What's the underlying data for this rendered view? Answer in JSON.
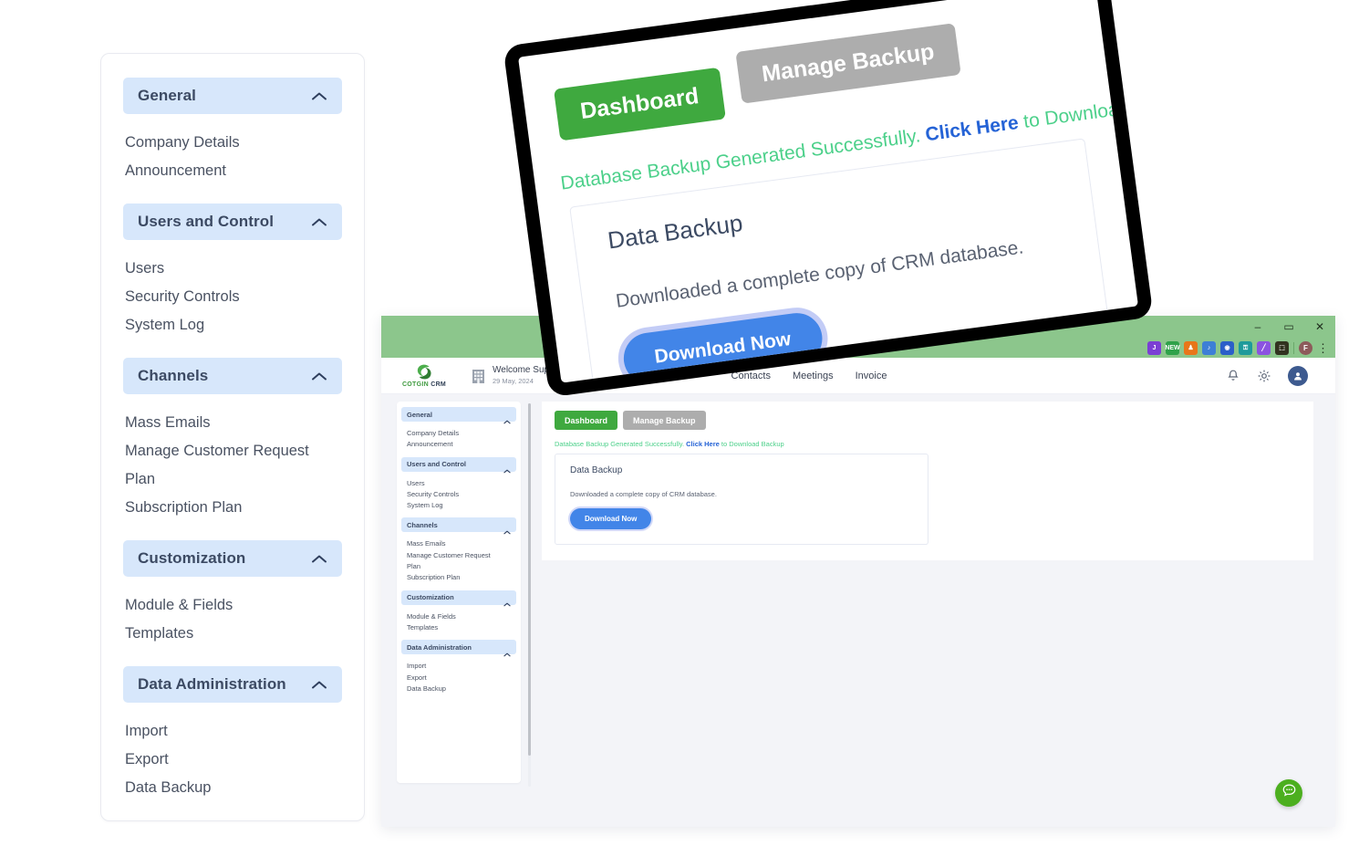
{
  "magnified_sidebar": {
    "groups": [
      {
        "title": "General",
        "chevron": "chevron-up-icon",
        "items": [
          "Company Details",
          "Announcement"
        ]
      },
      {
        "title": "Users and Control",
        "chevron": "chevron-up-icon",
        "items": [
          "Users",
          "Security Controls",
          "System Log"
        ]
      },
      {
        "title": "Channels",
        "chevron": "chevron-up-icon",
        "items": [
          "Mass Emails",
          "Manage Customer Request",
          "Plan",
          "Subscription Plan"
        ]
      },
      {
        "title": "Customization",
        "chevron": "chevron-up-icon",
        "items": [
          "Module & Fields",
          "Templates"
        ]
      },
      {
        "title": "Data Administration",
        "chevron": "chevron-up-icon",
        "items": [
          "Import",
          "Export",
          "Data Backup"
        ]
      }
    ]
  },
  "browser": {
    "window_controls": {
      "minimize": "–",
      "maximize": "▭",
      "close": "✕"
    },
    "extensions": [
      {
        "name": "extension-purple-icon",
        "glyph": "J",
        "color": "#7b3fd4"
      },
      {
        "name": "extension-new-badge-icon",
        "glyph": "NEW",
        "color": "#2fa24a"
      },
      {
        "name": "extension-orange-person-icon",
        "glyph": "♟",
        "color": "#e8761a"
      },
      {
        "name": "extension-blue-note-icon",
        "glyph": "♪",
        "color": "#3d7fd6"
      },
      {
        "name": "extension-target-icon",
        "glyph": "◉",
        "color": "#2b5fc9"
      },
      {
        "name": "extension-teal-lock-icon",
        "glyph": "⚿",
        "color": "#1e9b9b"
      },
      {
        "name": "extension-pencil-icon",
        "glyph": "╱",
        "color": "#8b53e0"
      },
      {
        "name": "extension-puzzle-icon",
        "glyph": "⬚",
        "color": "#31331f"
      }
    ],
    "profile_initial": "F",
    "menu_glyph": "⋮"
  },
  "app_header": {
    "logo_text_primary": "COTGIN",
    "logo_text_secondary": "CRM",
    "welcome_name": "Welcome Super Admin",
    "welcome_date": "29 May, 2024",
    "nav": [
      "Contacts",
      "Meetings",
      "Invoice"
    ],
    "icons": {
      "notifications": "bell-icon",
      "settings": "gear-icon",
      "profile": "user-avatar-icon"
    }
  },
  "mini_sidebar": {
    "groups": [
      {
        "title": "General",
        "items": [
          "Company Details",
          "Announcement"
        ]
      },
      {
        "title": "Users and Control",
        "items": [
          "Users",
          "Security Controls",
          "System Log"
        ]
      },
      {
        "title": "Channels",
        "items": [
          "Mass Emails",
          "Manage Customer Request",
          "Plan",
          "Subscription Plan"
        ]
      },
      {
        "title": "Customization",
        "items": [
          "Module & Fields",
          "Templates"
        ]
      },
      {
        "title": "Data Administration",
        "items": [
          "Import",
          "Export",
          "Data Backup"
        ]
      }
    ]
  },
  "main": {
    "tabs": [
      {
        "label": "Dashboard",
        "state": "active"
      },
      {
        "label": "Manage Backup",
        "state": "inactive"
      }
    ],
    "alert": {
      "prefix": "Database Backup Generated Successfully.",
      "link": "Click Here",
      "suffix": "to Download Backup"
    },
    "card": {
      "title": "Data Backup",
      "description": "Downloaded a complete copy of CRM database.",
      "button": "Download Now"
    },
    "chat_fab": "chat-bubble-icon"
  },
  "colors": {
    "tab_active_green": "#3fa93f",
    "tab_inactive_grey": "#adadad",
    "alert_green": "#4cd08a",
    "link_blue": "#2563d6",
    "button_blue": "#4285e8",
    "group_header_blue": "#d7e7fb",
    "browser_chrome_green": "#8cc68c",
    "page_background": "#f3f4f8",
    "chat_fab_green": "#4caf1f"
  }
}
